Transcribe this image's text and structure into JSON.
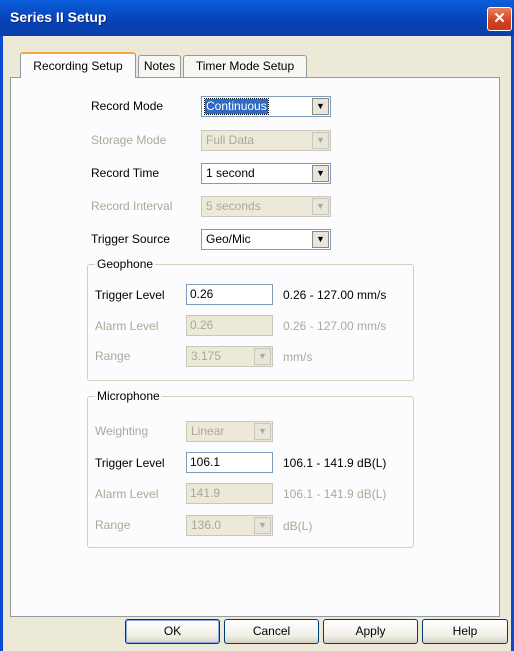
{
  "window": {
    "title": "Series II Setup",
    "close_glyph": "✕",
    "close_icon": "close-icon"
  },
  "tabs": [
    {
      "label": "Recording Setup",
      "active": true
    },
    {
      "label": "Notes",
      "active": false
    },
    {
      "label": "Timer Mode Setup",
      "active": false
    }
  ],
  "recording": {
    "record_mode": {
      "label": "Record Mode",
      "value": "Continuous",
      "enabled": true
    },
    "storage_mode": {
      "label": "Storage Mode",
      "value": "Full Data",
      "enabled": false
    },
    "record_time": {
      "label": "Record Time",
      "value": "1 second",
      "enabled": true
    },
    "record_interval": {
      "label": "Record Interval",
      "value": "5 seconds",
      "enabled": false
    },
    "trigger_source": {
      "label": "Trigger Source",
      "value": "Geo/Mic",
      "enabled": true
    }
  },
  "geophone": {
    "title": "Geophone",
    "trigger_level": {
      "label": "Trigger Level",
      "value": "0.26",
      "range": "0.26 - 127.00 mm/s",
      "enabled": true
    },
    "alarm_level": {
      "label": "Alarm Level",
      "value": "0.26",
      "range": "0.26 - 127.00 mm/s",
      "enabled": false
    },
    "range": {
      "label": "Range",
      "value": "3.175",
      "unit": "mm/s",
      "enabled": false
    }
  },
  "microphone": {
    "title": "Microphone",
    "weighting": {
      "label": "Weighting",
      "value": "Linear",
      "enabled": false
    },
    "trigger_level": {
      "label": "Trigger Level",
      "value": "106.1",
      "range": "106.1 - 141.9 dB(L)",
      "enabled": true
    },
    "alarm_level": {
      "label": "Alarm Level",
      "value": "141.9",
      "range": "106.1 - 141.9 dB(L)",
      "enabled": false
    },
    "range": {
      "label": "Range",
      "value": "136.0",
      "unit": "dB(L)",
      "enabled": false
    }
  },
  "buttons": {
    "ok": "OK",
    "cancel": "Cancel",
    "apply": "Apply",
    "help": "Help"
  },
  "dropdown_arrow": "▼",
  "colors": {
    "titlebar": "#0a4ad0",
    "selection": "#316ac5",
    "tab_accent": "#f8a83c",
    "disabled_text": "#aca899"
  }
}
